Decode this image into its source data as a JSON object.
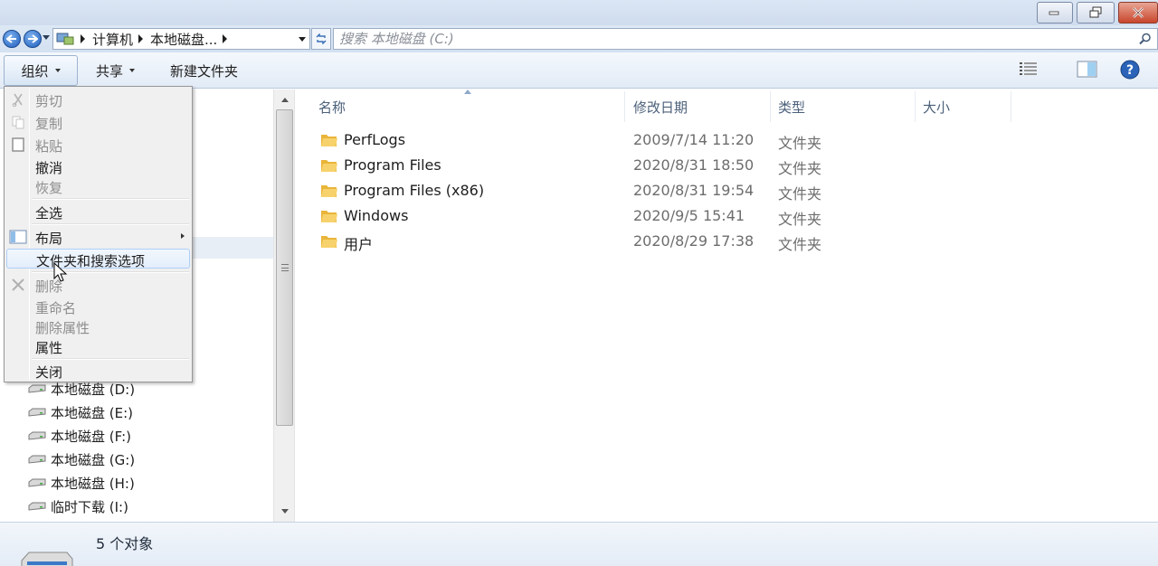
{
  "titlebar": {
    "minimize_icon": "minimize-icon",
    "maximize_icon": "restore-icon",
    "close_icon": "close-icon"
  },
  "address": {
    "crumbs": [
      "计算机",
      "本地磁盘..."
    ],
    "search_placeholder": "搜索 本地磁盘 (C:)"
  },
  "toolbar": {
    "organize": "组织",
    "share": "共享",
    "new_folder": "新建文件夹"
  },
  "context_menu": {
    "items": [
      {
        "label": "剪切",
        "enabled": false
      },
      {
        "label": "复制",
        "enabled": false
      },
      {
        "label": "粘贴",
        "enabled": false
      },
      {
        "label": "撤消",
        "enabled": true
      },
      {
        "label": "恢复",
        "enabled": false
      },
      {
        "label": "全选",
        "enabled": true
      },
      {
        "label": "布局",
        "enabled": true
      },
      {
        "label": "文件夹和搜索选项",
        "enabled": true
      },
      {
        "label": "删除",
        "enabled": false
      },
      {
        "label": "重命名",
        "enabled": false
      },
      {
        "label": "删除属性",
        "enabled": false
      },
      {
        "label": "属性",
        "enabled": true
      },
      {
        "label": "关闭",
        "enabled": true
      }
    ]
  },
  "nav": {
    "drives": [
      "本地磁盘 (D:)",
      "本地磁盘 (E:)",
      "本地磁盘 (F:)",
      "本地磁盘 (G:)",
      "本地磁盘 (H:)",
      "临时下载 (I:)"
    ]
  },
  "columns": {
    "name": "名称",
    "date": "修改日期",
    "type": "类型",
    "size": "大小"
  },
  "files": [
    {
      "name": "PerfLogs",
      "date": "2009/7/14 11:20",
      "type": "文件夹"
    },
    {
      "name": "Program Files",
      "date": "2020/8/31 18:50",
      "type": "文件夹"
    },
    {
      "name": "Program Files (x86)",
      "date": "2020/8/31 19:54",
      "type": "文件夹"
    },
    {
      "name": "Windows",
      "date": "2020/9/5 15:41",
      "type": "文件夹"
    },
    {
      "name": "用户",
      "date": "2020/8/29 17:38",
      "type": "文件夹"
    }
  ],
  "details": {
    "count": "5 个对象"
  },
  "colors": {
    "accent": "#1d5dbd",
    "folder": "#f0c048",
    "close_button": "#c9462c"
  }
}
